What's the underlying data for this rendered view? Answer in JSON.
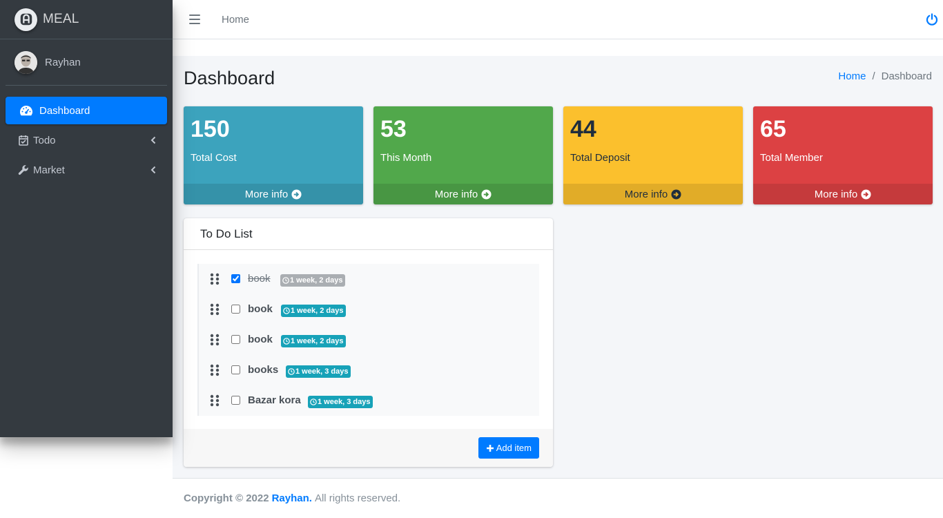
{
  "brand": {
    "name": "MEAL"
  },
  "user": {
    "name": "Rayhan"
  },
  "sidebar": {
    "items": [
      {
        "label": "Dashboard",
        "icon": "tachometer-icon",
        "active": true
      },
      {
        "label": "Todo",
        "icon": "calendar-check-icon",
        "has_children": true
      },
      {
        "label": "Market",
        "icon": "wrench-icon",
        "has_children": true
      }
    ]
  },
  "topbar": {
    "home_label": "Home",
    "menu_icon": "hamburger-icon",
    "power_icon": "power-icon"
  },
  "page": {
    "title": "Dashboard"
  },
  "breadcrumb": {
    "home": "Home",
    "separator": "/",
    "current": "Dashboard"
  },
  "stats": [
    {
      "value": "150",
      "label": "Total Cost",
      "link": "More info",
      "color": "#3ca3bd"
    },
    {
      "value": "53",
      "label": "This Month",
      "link": "More info",
      "color": "#51a84b"
    },
    {
      "value": "44",
      "label": "Total Deposit",
      "link": "More info",
      "color": "#fbc02d"
    },
    {
      "value": "65",
      "label": "Total Member",
      "link": "More info",
      "color": "#dc4143"
    }
  ],
  "todo": {
    "title": "To Do List",
    "items": [
      {
        "text": "book",
        "badge": "1 week, 2 days",
        "done": true
      },
      {
        "text": "book",
        "badge": "1 week, 2 days",
        "done": false
      },
      {
        "text": "book",
        "badge": "1 week, 2 days",
        "done": false
      },
      {
        "text": "books",
        "badge": "1 week, 3 days",
        "done": false
      },
      {
        "text": "Bazar kora",
        "badge": "1 week, 3 days",
        "done": false
      }
    ],
    "add_label": "Add item"
  },
  "footer": {
    "copyright": "Copyright © 2022",
    "author": "Rayhan.",
    "rights": "All rights reserved."
  },
  "colors": {
    "primary": "#007bff",
    "sidebar": "#343a40",
    "content_bg": "#f4f6f9"
  }
}
